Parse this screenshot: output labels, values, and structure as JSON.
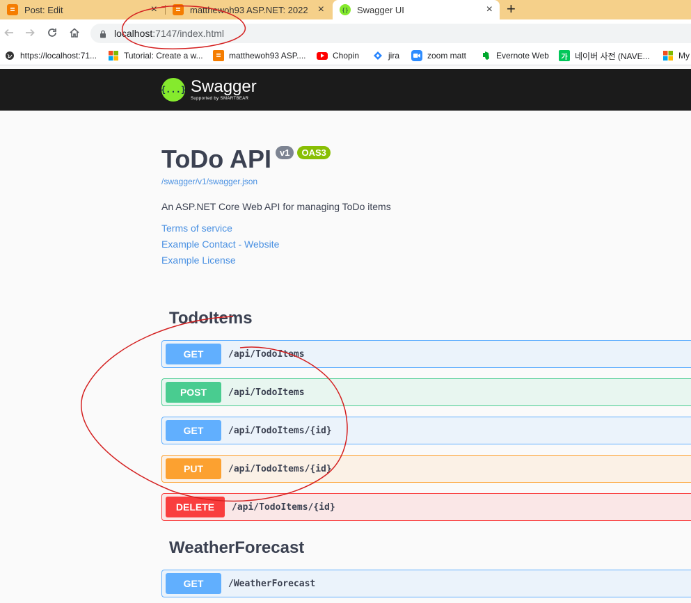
{
  "browser": {
    "tabs": [
      {
        "title": "Post: Edit",
        "icon": "blogger-icon"
      },
      {
        "title": "matthewoh93 ASP.NET: 2022",
        "icon": "blogger-icon"
      },
      {
        "title": "Swagger UI",
        "icon": "swagger-icon",
        "active": true
      }
    ],
    "new_tab": "+",
    "url_host": "localhost",
    "url_rest": ":7147/index.html",
    "bookmarks": [
      {
        "label": "https://localhost:71...",
        "icon": "globe-icon"
      },
      {
        "label": "Tutorial: Create a w...",
        "icon": "microsoft-icon"
      },
      {
        "label": "matthewoh93 ASP....",
        "icon": "blogger-icon"
      },
      {
        "label": "Chopin",
        "icon": "youtube-icon"
      },
      {
        "label": "jira",
        "icon": "jira-icon"
      },
      {
        "label": "zoom matt",
        "icon": "zoom-icon"
      },
      {
        "label": "Evernote Web",
        "icon": "evernote-icon"
      },
      {
        "label": "네이버 사전 (NAVE...",
        "icon": "naver-icon"
      },
      {
        "label": "My",
        "icon": "microsoft-icon"
      }
    ]
  },
  "swagger": {
    "logo_name": "Swagger",
    "logo_sub": "Supported by SMARTBEAR",
    "logo_mark": "{...}"
  },
  "info": {
    "title": "ToDo API",
    "version": "v1",
    "oas": "OAS3",
    "spec_url": "/swagger/v1/swagger.json",
    "description": "An ASP.NET Core Web API for managing ToDo items",
    "links": [
      "Terms of service",
      "Example Contact - Website",
      "Example License"
    ]
  },
  "sections": [
    {
      "name": "TodoItems",
      "operations": [
        {
          "method": "GET",
          "path": "/api/TodoItems"
        },
        {
          "method": "POST",
          "path": "/api/TodoItems"
        },
        {
          "method": "GET",
          "path": "/api/TodoItems/{id}"
        },
        {
          "method": "PUT",
          "path": "/api/TodoItems/{id}"
        },
        {
          "method": "DELETE",
          "path": "/api/TodoItems/{id}"
        }
      ]
    },
    {
      "name": "WeatherForecast",
      "operations": [
        {
          "method": "GET",
          "path": "/WeatherForecast"
        }
      ]
    }
  ],
  "colors": {
    "get": "#61affe",
    "post": "#49cc90",
    "put": "#fca130",
    "delete": "#f93e3e",
    "annotation": "#d42020"
  }
}
